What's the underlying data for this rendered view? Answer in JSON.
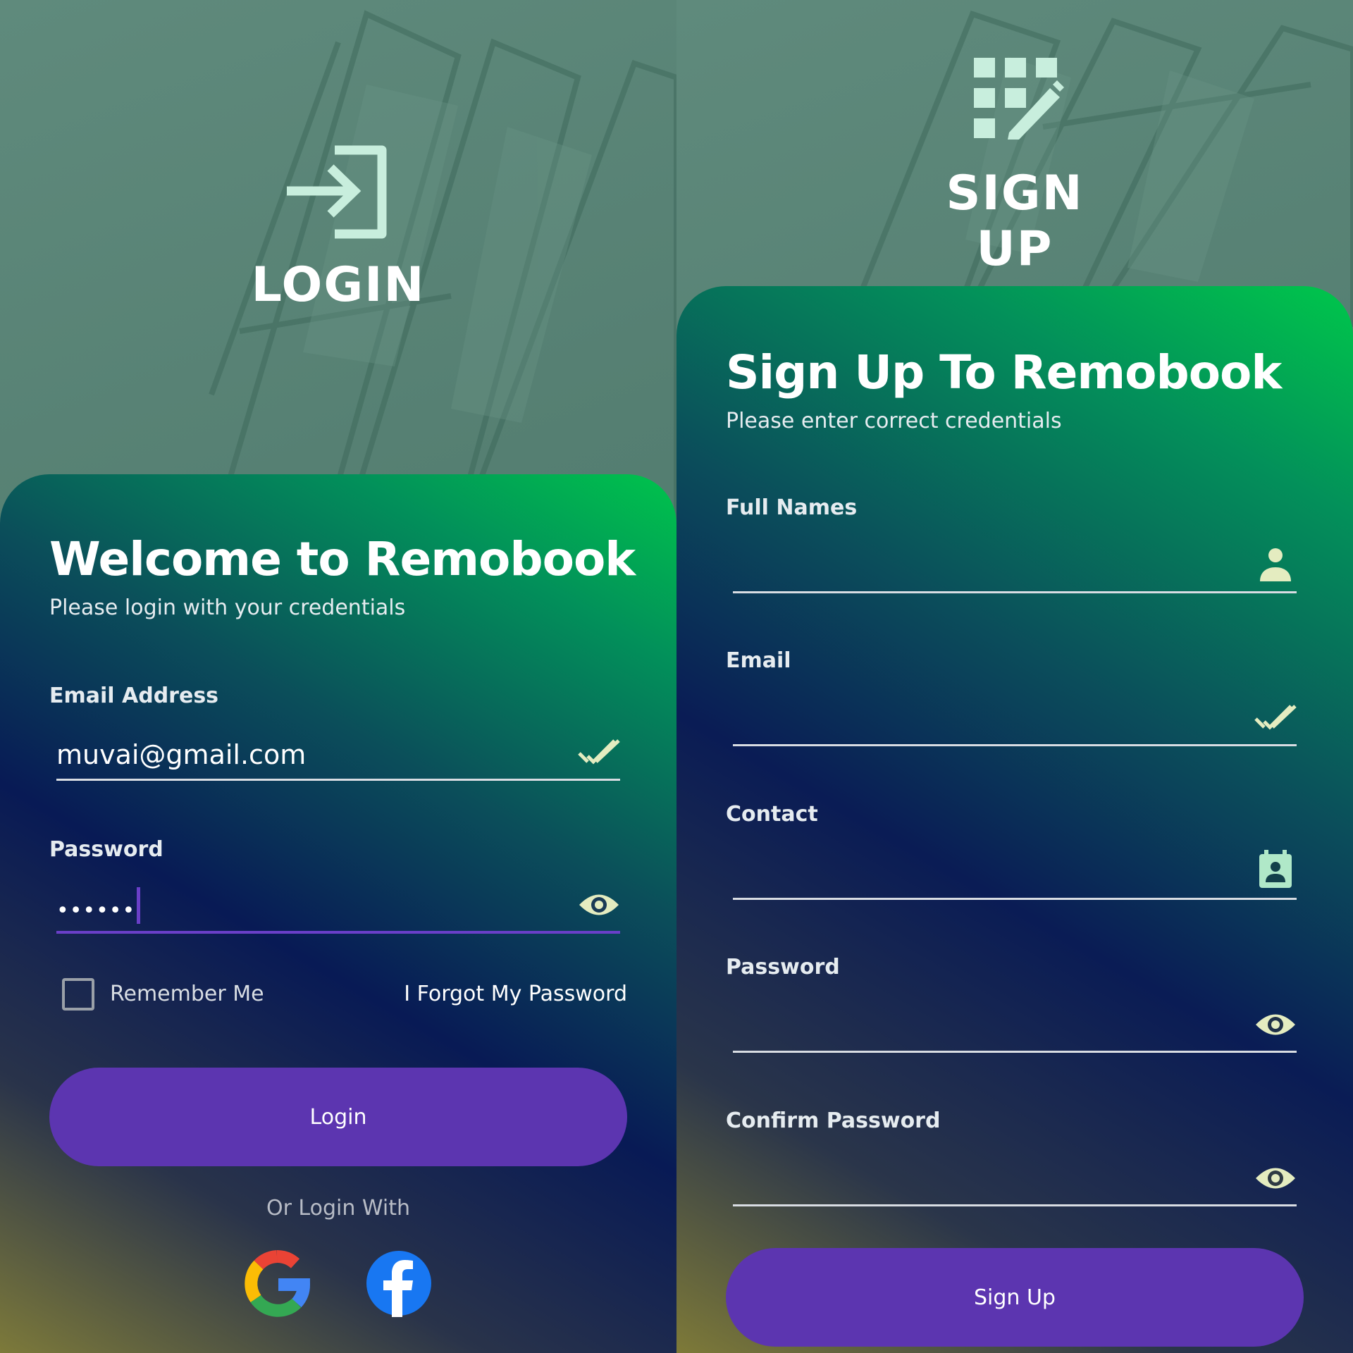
{
  "login_screen": {
    "hero_title": "LOGIN",
    "hero_icon": "login-arrow-icon",
    "card": {
      "title": "Welcome to Remobook",
      "subtitle": "Please login with your credentials"
    },
    "email": {
      "label": "Email Address",
      "value": "muvai@gmail.com",
      "icon": "double-check-icon"
    },
    "password": {
      "label": "Password",
      "value": "••••••",
      "icon": "eye-icon"
    },
    "remember_me": {
      "label": "Remember Me",
      "checked": false
    },
    "forgot_password": "I Forgot My Password",
    "login_button": "Login",
    "or_login_with": "Or Login With",
    "social": [
      "google-icon",
      "facebook-icon"
    ]
  },
  "signup_screen": {
    "hero_title": "SIGN UP",
    "hero_icon": "signup-grid-pencil-icon",
    "card": {
      "title": "Sign Up To Remobook",
      "subtitle": "Please enter correct credentials"
    },
    "fields": [
      {
        "label": "Full Names",
        "value": "",
        "icon": "person-icon"
      },
      {
        "label": "Email",
        "value": "",
        "icon": "double-check-icon"
      },
      {
        "label": "Contact",
        "value": "",
        "icon": "contact-badge-icon"
      },
      {
        "label": "Password",
        "value": "",
        "icon": "eye-icon"
      },
      {
        "label": "Confirm Password",
        "value": "",
        "icon": "eye-icon"
      }
    ],
    "signup_button": "Sign Up"
  },
  "colors": {
    "accent": "#5c35b0",
    "icon_tint": "#c8eedd",
    "field_icon_tint": "#e4ecc0"
  }
}
